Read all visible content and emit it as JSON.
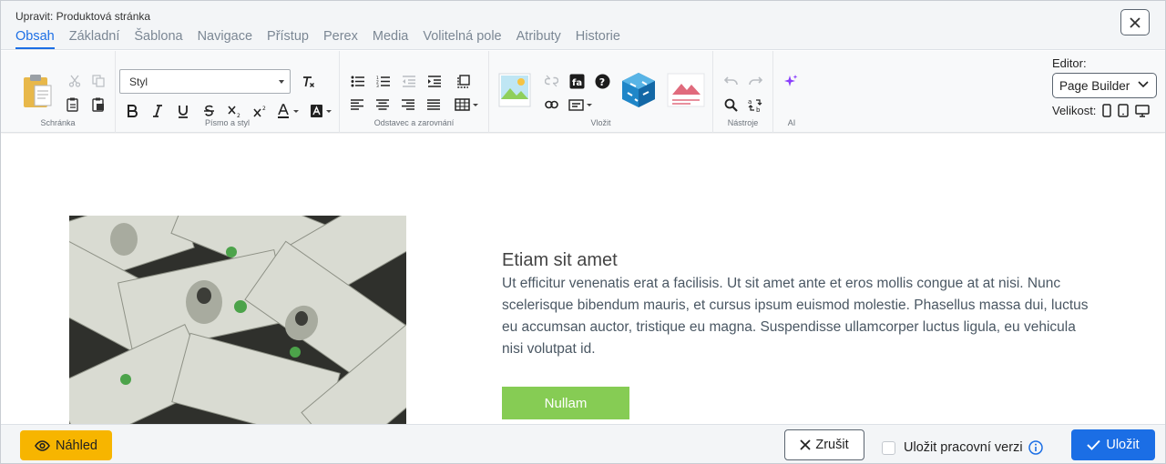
{
  "header": {
    "title": "Upravit: Produktová stránka",
    "tabs": [
      {
        "label": "Obsah",
        "active": true
      },
      {
        "label": "Základní"
      },
      {
        "label": "Šablona"
      },
      {
        "label": "Navigace"
      },
      {
        "label": "Přístup"
      },
      {
        "label": "Perex"
      },
      {
        "label": "Media"
      },
      {
        "label": "Volitelná pole"
      },
      {
        "label": "Atributy"
      },
      {
        "label": "Historie"
      }
    ]
  },
  "toolbar": {
    "groups": {
      "clipboard": "Schránka",
      "font": "Písmo a styl",
      "paragraph": "Odstavec a zarovnání",
      "insert": "Vložit",
      "tools": "Nástroje",
      "ai": "AI"
    },
    "style_select": "Styl",
    "editor_label": "Editor:",
    "editor_value": "Page Builder",
    "size_label": "Velikost:"
  },
  "content": {
    "heading": "Etiam sit amet",
    "body": "Ut efficitur venenatis erat a facilisis. Ut sit amet ante et eros mollis congue at at nisi. Nunc scelerisque bibendum mauris, et cursus ipsum euismod molestie. Phasellus massa dui, luctus eu accumsan auctor, tristique eu magna. Suspendisse ullamcorper luctus ligula, eu vehicula nisi volutpat id.",
    "button": "Nullam"
  },
  "footer": {
    "preview": "Náhled",
    "cancel": "Zrušit",
    "draft_checkbox": "Uložit pracovní verzi",
    "draft_checked": false,
    "save": "Uložit"
  },
  "colors": {
    "accent": "#1b6ee5",
    "preview_button": "#f7b500",
    "cta_button": "#86cc54",
    "ai_icon": "#8a3ffc"
  }
}
